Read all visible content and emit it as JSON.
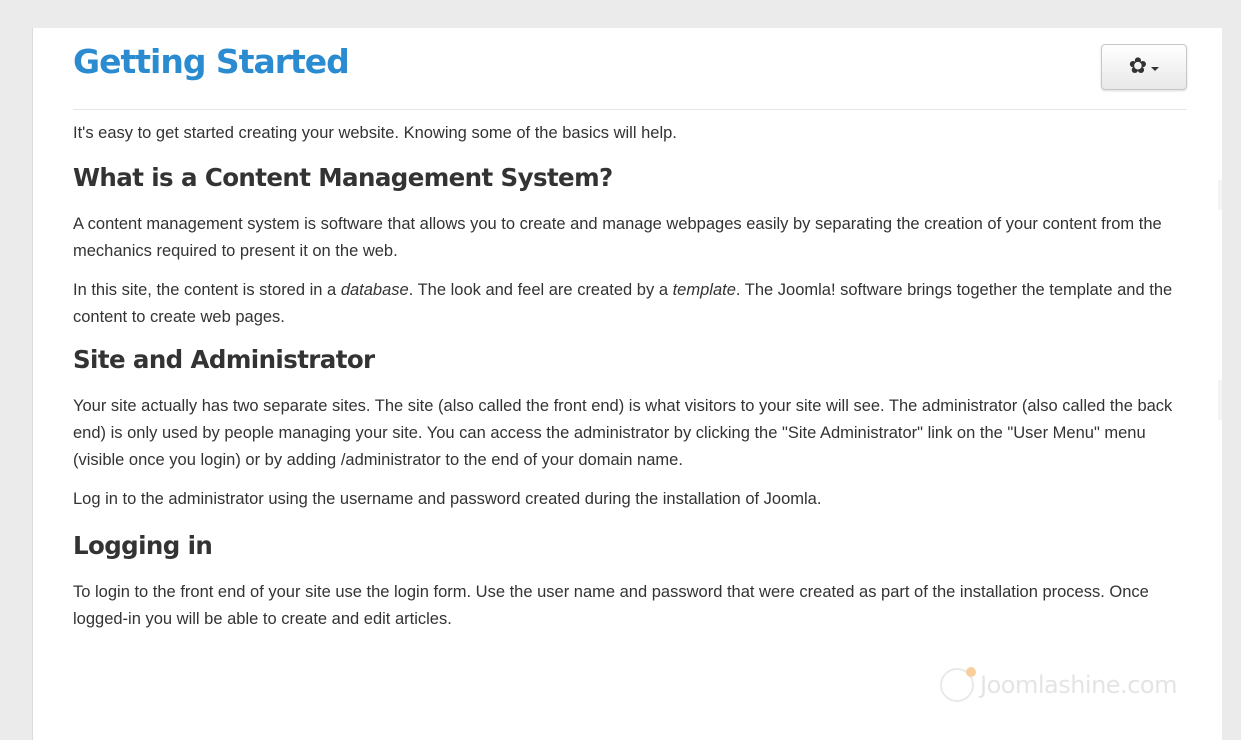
{
  "page": {
    "title": "Getting Started"
  },
  "toolbar": {
    "gear_icon": "gear-icon",
    "gear_glyph": "✿"
  },
  "article": {
    "intro": "It's easy to get started creating your website. Knowing some of the basics will help.",
    "section_cms": {
      "heading": "What is a Content Management System?",
      "p1": "A content management system is software that allows you to create and manage webpages easily by separating the creation of your content from the mechanics required to present it on the web.",
      "p2_before_db": "In this site, the content is stored in a ",
      "p2_db": "database",
      "p2_middle": ". The look and feel are created by a ",
      "p2_template": "template",
      "p2_after": ". The Joomla! software brings together the template and the content to create web pages."
    },
    "section_site": {
      "heading": "Site and Administrator",
      "p1": "Your site actually has two separate sites. The site (also called the front end) is what visitors to your site will see. The administrator (also called the back end) is only used by people managing your site. You can access the administrator by clicking the \"Site Administrator\" link on the \"User Menu\" menu (visible once you login) or by adding /administrator to the end of your domain name.",
      "p2": "Log in to the administrator using the username and password created during the installation of Joomla."
    },
    "section_login": {
      "heading": "Logging in",
      "p1": "To login to the front end of your site use the login form. Use the user name and password that were created as part of the installation process. Once logged-in you will be able to create and edit articles."
    }
  },
  "watermark": {
    "text": "Joomlashine.com"
  },
  "colors": {
    "title": "#2a8bd0",
    "text": "#333333",
    "background": "#ebebeb",
    "card": "#ffffff"
  }
}
